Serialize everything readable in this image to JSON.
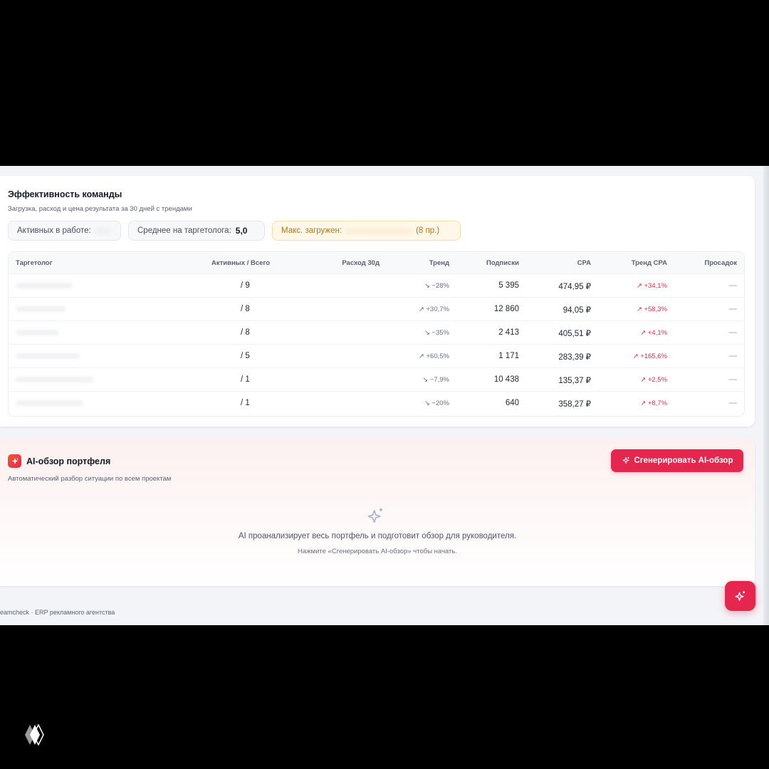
{
  "team": {
    "title": "Эффективность команды",
    "subtitle": "Загрузка, расход и цена результата за 30 дней с трендами",
    "stats": {
      "active_label": "Активных в работе:",
      "avg_label": "Среднее на таргетолога:",
      "avg_value": "5,0",
      "max_label": "Макс. загружен:",
      "max_value": "(8 пр.)"
    },
    "columns": {
      "name": "Таргетолог",
      "active": "Активных / Всего",
      "spend": "Расход 30д",
      "trend": "Тренд",
      "subs": "Подписки",
      "cpa": "CPA",
      "cpa_trend": "Тренд CPA",
      "drawdowns": "Просадок"
    },
    "rows": [
      {
        "active": "/ 9",
        "trend": "↘ −28%",
        "subs": "5 395",
        "cpa": "474,95 ₽",
        "cpa_trend": "↗ +34,1%",
        "drawdowns": "—"
      },
      {
        "active": "/ 8",
        "trend": "↗ +30,7%",
        "subs": "12 860",
        "cpa": "94,05 ₽",
        "cpa_trend": "↗ +58,3%",
        "drawdowns": "—"
      },
      {
        "active": "/ 8",
        "trend": "↘ −35%",
        "subs": "2 413",
        "cpa": "405,51 ₽",
        "cpa_trend": "↗ +4,1%",
        "drawdowns": "—"
      },
      {
        "active": "/ 5",
        "trend": "↗ +60,5%",
        "subs": "1 171",
        "cpa": "283,39 ₽",
        "cpa_trend": "↗ +165,6%",
        "drawdowns": "—"
      },
      {
        "active": "/ 1",
        "trend": "↘ −7,9%",
        "subs": "10 438",
        "cpa": "135,37 ₽",
        "cpa_trend": "↗ +2,5%",
        "drawdowns": "—"
      },
      {
        "active": "/ 1",
        "trend": "↘ −20%",
        "subs": "640",
        "cpa": "358,27 ₽",
        "cpa_trend": "↗ +8,7%",
        "drawdowns": "—"
      }
    ]
  },
  "ai": {
    "title": "AI-обзор портфеля",
    "subtitle": "Автоматический разбор ситуации по всем проектам",
    "button_label": "Сгенерировать AI-обзор",
    "empty_main": "AI проанализирует весь портфель и подготовит обзор для руководителя.",
    "empty_hint": "Нажмите «Сгенерировать AI-обзор» чтобы начать."
  },
  "footer": {
    "text": "eamcheck · ERP рекламного агентства"
  },
  "colors": {
    "accent": "#e5264e",
    "negative_trend": "#e0324a",
    "warning_bg": "#fff8e9",
    "warning_text": "#b07718"
  },
  "icons": {
    "ai_badge": "sparkles-icon",
    "generate_button": "sparkles-icon",
    "empty_state": "sparkles-icon",
    "fab": "sparkles-icon",
    "corner_logo": "diamond-logo-icon"
  }
}
